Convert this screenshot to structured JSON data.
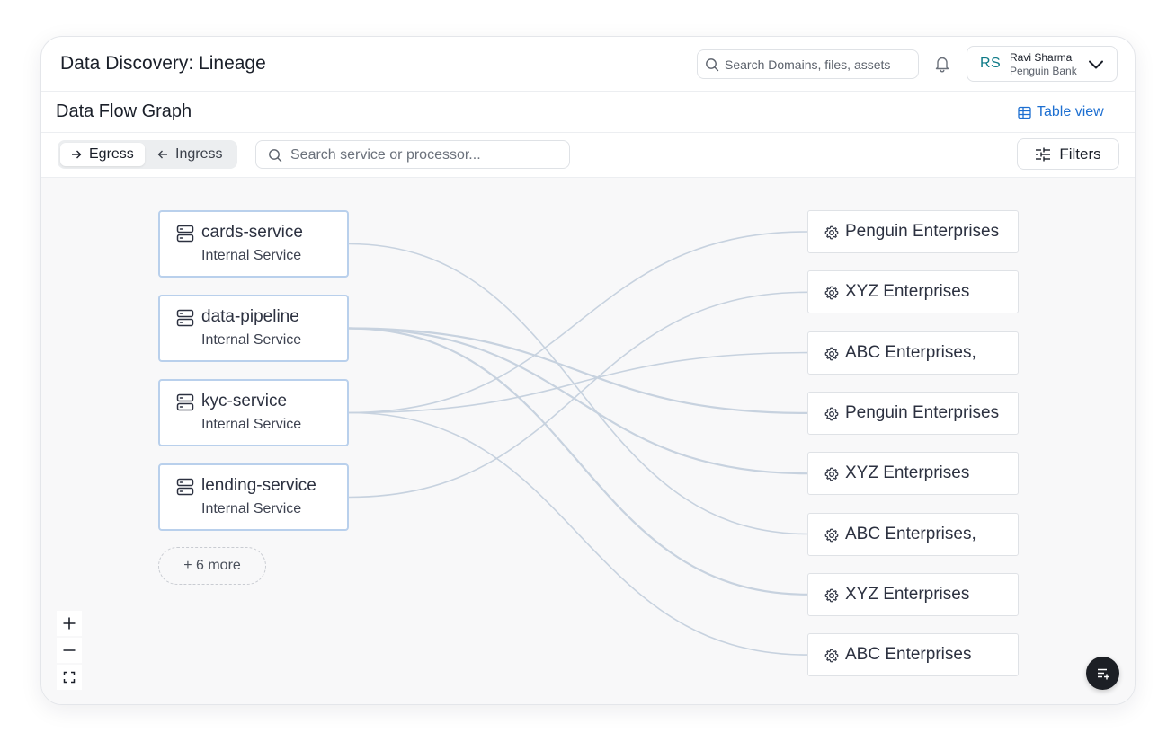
{
  "header": {
    "title": "Data Discovery: Lineage",
    "search_placeholder": "Search Domains, files, assets",
    "user": {
      "initials": "RS",
      "name": "Ravi Sharma",
      "org": "Penguin Bank"
    }
  },
  "section": {
    "title": "Data Flow Graph",
    "table_view_label": "Table view"
  },
  "toolbar": {
    "direction_options": [
      {
        "label": "Egress",
        "icon": "arrow-right-icon",
        "active": true
      },
      {
        "label": "Ingress",
        "icon": "arrow-left-icon",
        "active": false
      }
    ],
    "search_placeholder": "Search service or processor...",
    "filters_label": "Filters"
  },
  "graph": {
    "sources": [
      {
        "name": "cards-service",
        "type": "Internal Service"
      },
      {
        "name": "data-pipeline",
        "type": "Internal Service"
      },
      {
        "name": "kyc-service",
        "type": "Internal Service"
      },
      {
        "name": "lending-service",
        "type": "Internal Service"
      }
    ],
    "more_label": "+ 6 more",
    "destinations": [
      {
        "name": "Penguin Enterprises"
      },
      {
        "name": "XYZ Enterprises"
      },
      {
        "name": "ABC Enterprises,"
      },
      {
        "name": "Penguin Enterprises"
      },
      {
        "name": "XYZ Enterprises"
      },
      {
        "name": "ABC Enterprises,"
      },
      {
        "name": "XYZ Enterprises"
      },
      {
        "name": "ABC Enterprises"
      }
    ],
    "edges": [
      {
        "from": 0,
        "to": 5
      },
      {
        "from": 1,
        "to": 3
      },
      {
        "from": 1,
        "to": 4
      },
      {
        "from": 1,
        "to": 6
      },
      {
        "from": 2,
        "to": 0
      },
      {
        "from": 2,
        "to": 2
      },
      {
        "from": 2,
        "to": 7
      },
      {
        "from": 3,
        "to": 1
      }
    ]
  },
  "controls": {
    "zoom_in": "+",
    "zoom_out": "−"
  },
  "colors": {
    "accent": "#1d6fd1",
    "initials": "#0e7a87",
    "node_border": "#b9d0ec",
    "edge": "#c7d2df",
    "canvas": "#f8f8f9"
  }
}
